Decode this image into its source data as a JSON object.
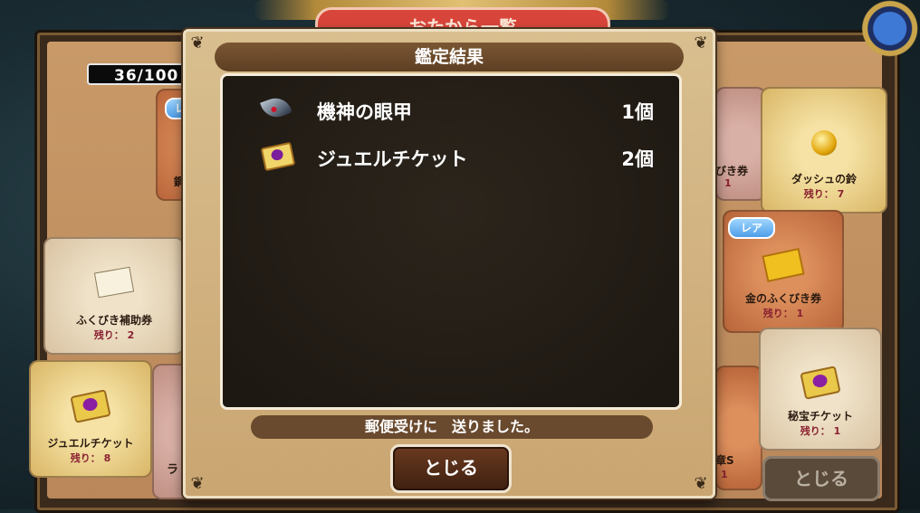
{
  "background": {
    "list_title": "おたから一覧",
    "counter": "36/100",
    "close_label": "とじる",
    "cards": [
      {
        "name": "ふくびき補助券",
        "remaining": "残り： 2"
      },
      {
        "name": "ジュエルチケット",
        "remaining": "残り： 8"
      },
      {
        "name": "ダッシュの鈴",
        "remaining": "残り： 7"
      },
      {
        "name": "金のふくびき券",
        "remaining": "残り： 1"
      },
      {
        "name": "秘宝チケット",
        "remaining": "残り： 1"
      }
    ],
    "partial_texts": {
      "left_top_card": "鋼",
      "left_bottom_card": "ラ",
      "right_top_card": "びき券",
      "right_top_remain": "1",
      "right_bottom_card": "章S",
      "right_bottom_remain": "1"
    },
    "rare_badge": "レア",
    "rare_badge_partial": "レ"
  },
  "dialog": {
    "title": "鑑定結果",
    "results": [
      {
        "name": "機神の眼甲",
        "qty": "1個",
        "icon": "armor-icon"
      },
      {
        "name": "ジュエルチケット",
        "qty": "2個",
        "icon": "jewel-ticket-icon"
      }
    ],
    "message": "郵便受けに　送りました。",
    "close_label": "とじる"
  }
}
